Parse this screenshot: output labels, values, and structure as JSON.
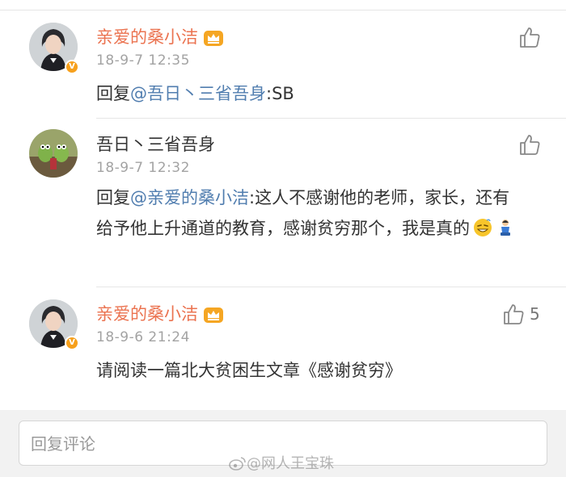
{
  "comments": [
    {
      "author": "亲爱的桑小洁",
      "time": "18-9-7 12:35",
      "reply_prefix": "回复",
      "mention": "@吾日丶三省吾身",
      "text": ":SB",
      "likes": ""
    },
    {
      "author": "吾日丶三省吾身",
      "time": "18-9-7 12:32",
      "reply_prefix": "回复",
      "mention": "@亲爱的桑小洁",
      "text": ":这人不感谢他的老师，家长，还有给予他上升通道的教育，感谢贫穷那个，我是真的",
      "likes": ""
    },
    {
      "author": "亲爱的桑小洁",
      "time": "18-9-6 21:24",
      "text": "请阅读一篇北大贫困生文章《感谢贫穷》",
      "likes": "5"
    }
  ],
  "reply_input": {
    "placeholder": "回复评论"
  },
  "watermark": "@网人王宝珠",
  "colors": {
    "author_orange": "#eb7350",
    "mention_blue": "#507daf",
    "verified_badge": "#f7a01c"
  },
  "icons": {
    "like": "thumbs-up-icon",
    "crown": "crown-badge-icon",
    "verified": "verified-v-icon"
  }
}
